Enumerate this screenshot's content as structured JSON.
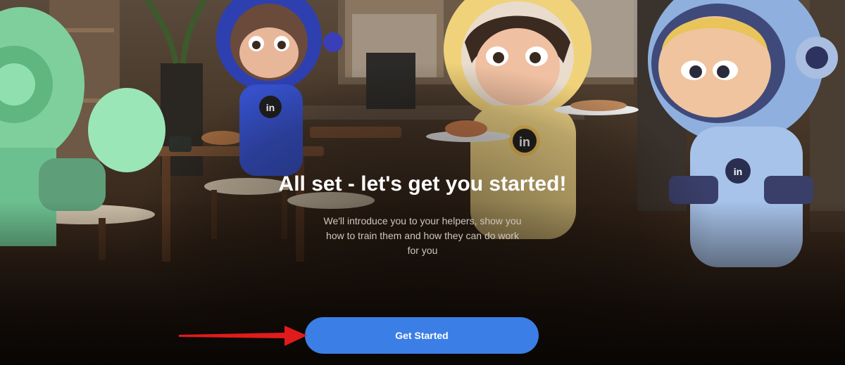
{
  "onboarding": {
    "title": "All set - let's get you started!",
    "subtitle": "We'll introduce you to your helpers, show you how to train them and how they can do work for you",
    "cta_label": "Get Started",
    "badge_text": "in"
  },
  "colors": {
    "cta_background": "#3b7fe6",
    "cta_text": "#ffffff",
    "title_text": "#ffffff",
    "subtitle_text": "#cfc6bd",
    "annotation_arrow": "#e01b1b"
  },
  "annotation": {
    "type": "red-arrow",
    "points_to": "get-started-button"
  }
}
